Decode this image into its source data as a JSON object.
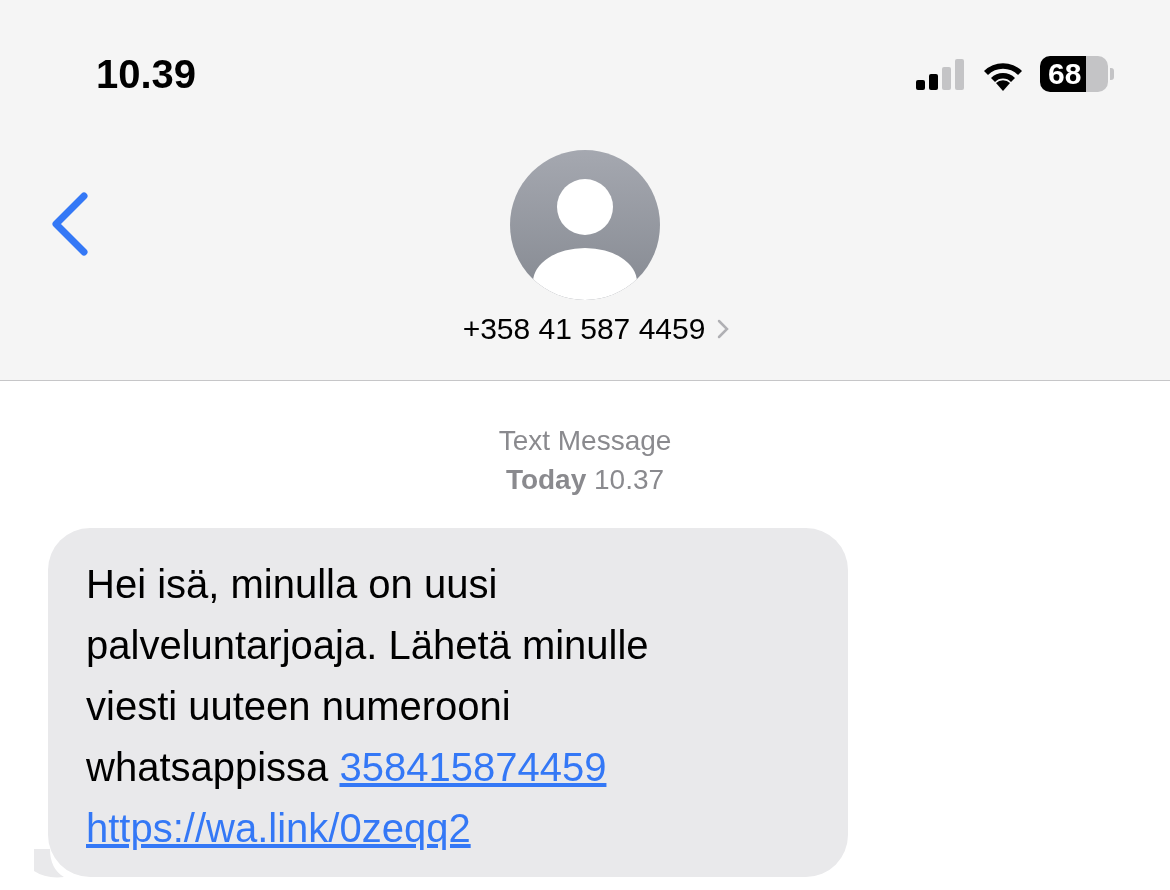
{
  "status_bar": {
    "time": "10.39",
    "battery": "68"
  },
  "header": {
    "contact": "+358 41 587 4459"
  },
  "thread": {
    "service": "Text Message",
    "timestamp": "**Today** 10.37"
  },
  "message": {
    "lines": [
      [
        {
          "kind": "text",
          "text": "Hei isä, minulla on uusi"
        }
      ],
      [
        {
          "kind": "text",
          "text": "palveluntarjoaja. Lähetä minulle"
        }
      ],
      [
        {
          "kind": "text",
          "text": "viesti uuteen numerooni"
        }
      ],
      [
        {
          "kind": "text",
          "text": "whatsappissa "
        },
        {
          "kind": "link",
          "text": "358415874459"
        }
      ],
      [
        {
          "kind": "link",
          "text": "https://wa.link/0zeqq2"
        }
      ]
    ]
  }
}
